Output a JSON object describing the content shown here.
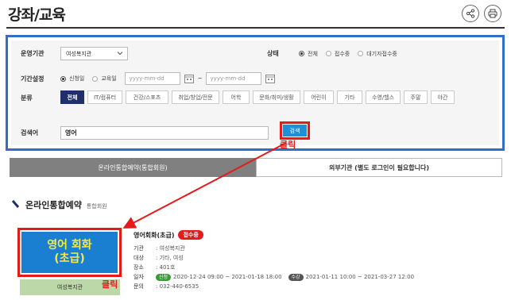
{
  "page": {
    "title": "강좌/교육"
  },
  "icons": {
    "share": "share-icon",
    "print": "print-icon"
  },
  "filters": {
    "operator_label": "운영기관",
    "operator_value": "여성복지관",
    "status_label": "상태",
    "status_options": [
      "전체",
      "접수중",
      "대기자접수중"
    ],
    "status_selected": "전체",
    "period_label": "기간설정",
    "period_options": [
      "신청일",
      "교육일"
    ],
    "period_selected": "신청일",
    "date_from_placeholder": "yyyy-mm-dd",
    "date_sep": "~",
    "date_to_placeholder": "yyyy-mm-dd",
    "category_label": "분류",
    "categories": [
      "전체",
      "IT/컴퓨터",
      "건강/스포츠",
      "취업/창업/전문",
      "어학",
      "문화/취미/생활",
      "어린이",
      "기타",
      "수영/헬스",
      "주말",
      "야간"
    ],
    "category_selected": "전체",
    "keyword_label": "검색어",
    "keyword_value": "영어",
    "search_button": "검색"
  },
  "annotations": {
    "click_1": "클릭",
    "click_2": "클릭"
  },
  "tabs": [
    {
      "label": "온라인통합예약(통합회원)",
      "active": true
    },
    {
      "label": "외부기관 (별도 로그인이 필요합니다)",
      "active": false
    }
  ],
  "section": {
    "title": "온라인통합예약",
    "subtitle": "통합회원"
  },
  "course": {
    "thumb_line1": "영어 회화",
    "thumb_line2": "(초급)",
    "org_strip": "여성복지관",
    "name": "영어회화(초급)",
    "status_badge": "접수중",
    "institution_key": "기관",
    "institution_val": ": 여성복지관",
    "target_key": "대상",
    "target_val": ": 기타, 여성",
    "place_key": "장소",
    "place_val": ": 401호",
    "schedule_key": "일자",
    "schedule_tag1": "신청",
    "schedule_val1": "2020-12-24 09:00 ~ 2021-01-18 18:00",
    "schedule_tag2": "수강",
    "schedule_val2": "2021-01-11 10:00 ~ 2021-03-27 12:00",
    "contact_key": "문의",
    "contact_val": ": 032-440-6535"
  },
  "colors": {
    "highlight_red": "#e31b1b",
    "panel_border": "#2f6fc9",
    "search_blue": "#1f8fd6",
    "category_active": "#1f2f6b"
  }
}
